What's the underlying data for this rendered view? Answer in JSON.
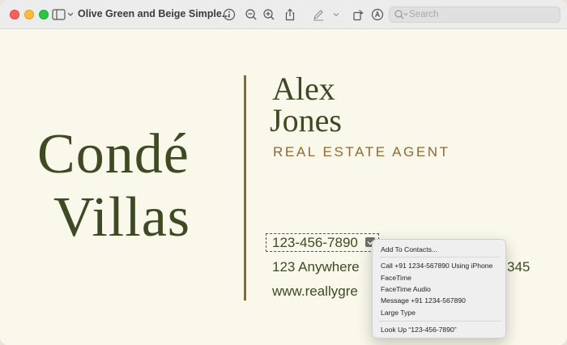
{
  "window": {
    "title": "Olive Green and Beige Simple...",
    "search_placeholder": "Search"
  },
  "card": {
    "brand_line1": "Condé",
    "brand_line2": "Villas",
    "name_line1": "Alex",
    "name_line2": "Jones",
    "role": "REAL ESTATE AGENT",
    "phone": "123-456-7890",
    "address_visible": "123 Anywhere",
    "address_tail": "345",
    "website_visible": "www.reallygre"
  },
  "context_menu": {
    "items": [
      "Add To Contacts...",
      "Call +91 1234-567890 Using iPhone",
      "FaceTime",
      "FaceTime Audio",
      "Message +91 1234-567890",
      "Large Type",
      "Look Up “123-456-7890”"
    ]
  },
  "colors": {
    "olive": "#3d4a22",
    "gold": "#8f6a2f",
    "background": "#faf8ea"
  }
}
